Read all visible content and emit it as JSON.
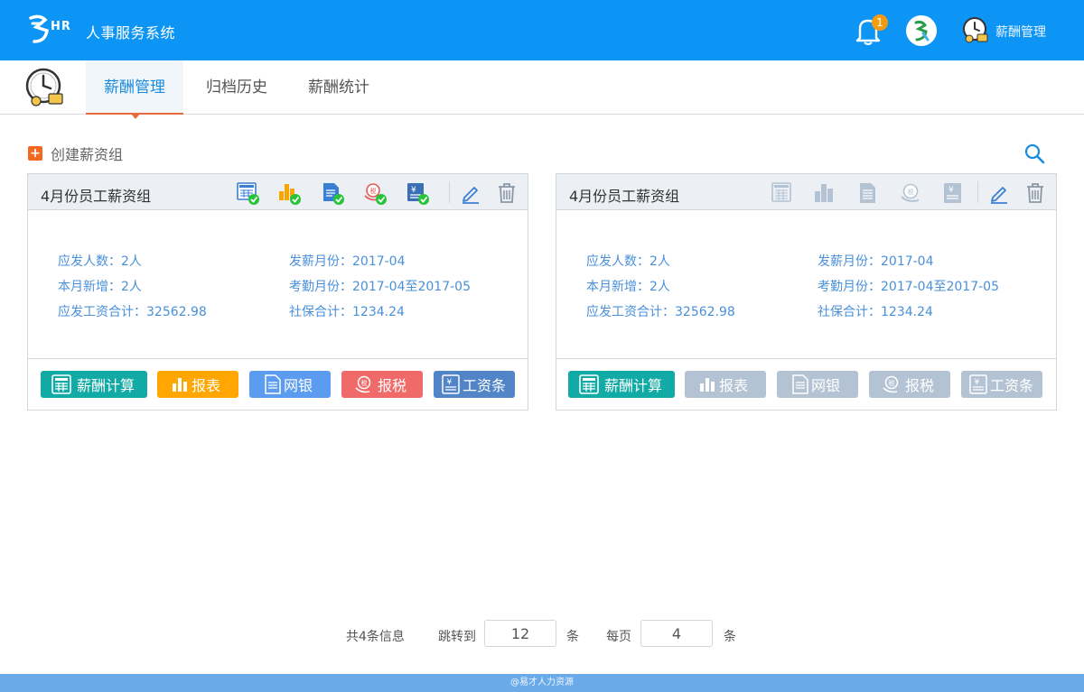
{
  "header": {
    "app_title": "人事服务系统",
    "logo_text": "HR",
    "notification_count": "1",
    "user_module": "薪酬管理"
  },
  "tabs": [
    {
      "label": "薪酬管理",
      "active": true
    },
    {
      "label": "归档历史",
      "active": false
    },
    {
      "label": "薪酬统计",
      "active": false
    }
  ],
  "toolbar": {
    "create_label": "创建薪资组"
  },
  "cards": [
    {
      "title": "4月份员工薪资组",
      "status": "complete",
      "info_left": [
        "应发人数：2人",
        "本月新增：2人",
        "应发工资合计：32562.98"
      ],
      "info_right": [
        "发薪月份：2017-04",
        "考勤月份：2017-04至2017-05",
        "社保合计：1234.24"
      ],
      "buttons": [
        "薪酬计算",
        "报表",
        "网银",
        "报税",
        "工资条"
      ]
    },
    {
      "title": "4月份员工薪资组",
      "status": "pending",
      "info_left": [
        "应发人数：2人",
        "本月新增：2人",
        "应发工资合计：32562.98"
      ],
      "info_right": [
        "发薪月份：2017-04",
        "考勤月份：2017-04至2017-05",
        "社保合计：1234.24"
      ],
      "buttons": [
        "薪酬计算",
        "报表",
        "网银",
        "报税",
        "工资条"
      ]
    }
  ],
  "pagination": {
    "total_text": "共4条信息",
    "jump_label": "跳转到",
    "jump_value": "12",
    "unit": "条",
    "per_page_label": "每页",
    "per_page_value": "4"
  },
  "footer": {
    "text": "@易才人力资源"
  },
  "colors": {
    "topbar": "#0d95f5",
    "accent": "#1a8ce0",
    "active_underline": "#e86a3c",
    "teal": "#12aaa4",
    "orange": "#ffa600",
    "blue": "#5b9cf0",
    "red": "#f06a6a",
    "navy": "#5185c8",
    "disabled": "#b3c3d3"
  }
}
